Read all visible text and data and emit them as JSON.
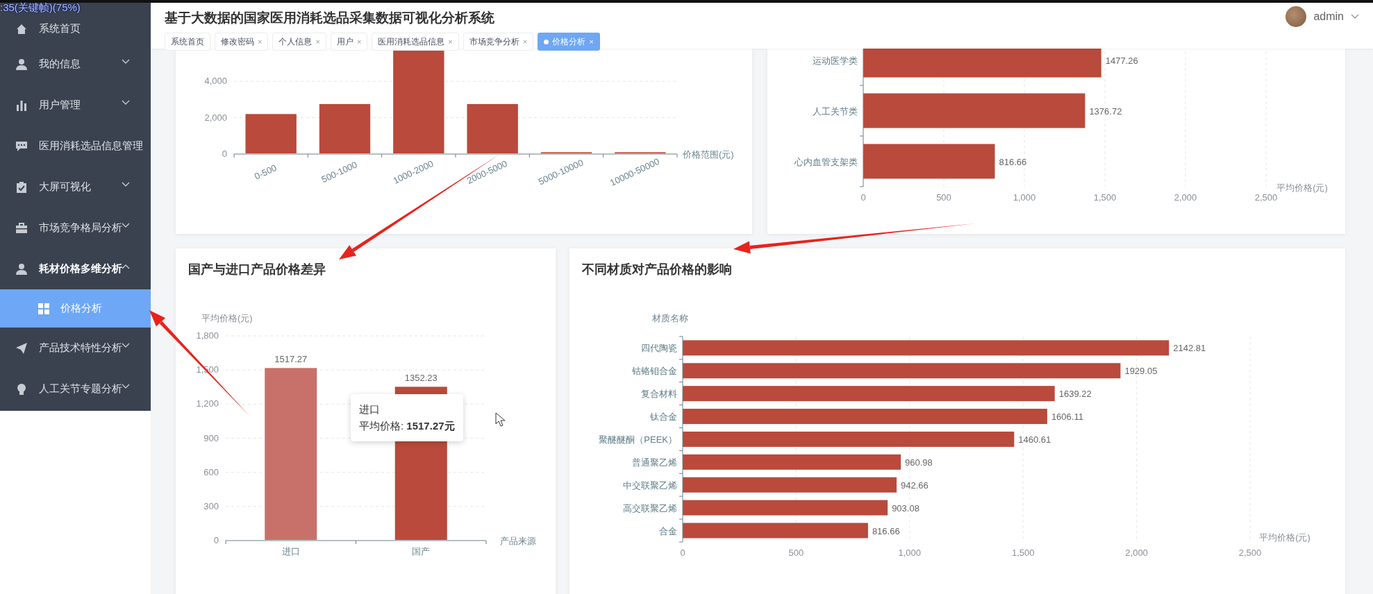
{
  "overlay_text": ":35(关键帧)(75%)",
  "sidebar": {
    "items": [
      {
        "label": "系统首页",
        "kind": "link",
        "expanded": false,
        "selected": false
      },
      {
        "label": "我的信息",
        "kind": "menu",
        "expanded": false,
        "selected": false
      },
      {
        "label": "用户管理",
        "kind": "menu",
        "expanded": false,
        "selected": false
      },
      {
        "label": "医用消耗选品信息管理",
        "kind": "link",
        "expanded": false,
        "selected": false
      },
      {
        "label": "大屏可视化",
        "kind": "menu",
        "expanded": false,
        "selected": false
      },
      {
        "label": "市场竞争格局分析",
        "kind": "menu",
        "expanded": false,
        "selected": false
      },
      {
        "label": "耗材价格多维分析",
        "kind": "menu",
        "expanded": true,
        "selected": false,
        "children": [
          {
            "label": "价格分析",
            "selected": true
          }
        ]
      },
      {
        "label": "产品技术特性分析",
        "kind": "menu",
        "expanded": false,
        "selected": false
      },
      {
        "label": "人工关节专题分析",
        "kind": "menu",
        "expanded": false,
        "selected": false
      }
    ]
  },
  "header": {
    "title": "基于大数据的国家医用消耗选品采集数据可视化分析系统",
    "user": "admin"
  },
  "tabs": [
    {
      "label": "系统首页",
      "selected": false
    },
    {
      "label": "修改密码",
      "close": "×",
      "selected": false
    },
    {
      "label": "个人信息",
      "close": "×",
      "selected": false
    },
    {
      "label": "用户",
      "close": "×",
      "selected": false
    },
    {
      "label": "医用消耗选品信息",
      "close": "×",
      "selected": false
    },
    {
      "label": "市场竞争分析",
      "close": "×",
      "selected": false
    },
    {
      "label": "价格分析",
      "close": "×",
      "selected": true
    }
  ],
  "price_range_card": {
    "chart_data": {
      "type": "bar",
      "xlabel": "价格范围(元)",
      "categories": [
        "0-500",
        "500-1000",
        "1000-2000",
        "2000-5000",
        "5000-10000",
        "10000-50000"
      ],
      "values": [
        2200,
        2750,
        5700,
        2750,
        100,
        100
      ],
      "ylim": [
        0,
        5800
      ],
      "grid": true,
      "yticks": [
        {
          "value": 0,
          "label": "0"
        },
        {
          "value": 2000,
          "label": "2,000"
        },
        {
          "value": 4000,
          "label": "4,000"
        }
      ]
    }
  },
  "category_card": {
    "chart_data": {
      "type": "bar",
      "orientation": "horizontal",
      "xlabel": "平均价格(元)",
      "categories": [
        "运动医学类",
        "人工关节类",
        "心内血管支架类"
      ],
      "values": [
        1477.26,
        1376.72,
        816.66
      ],
      "xlim": [
        0,
        2500
      ],
      "grid": true,
      "xticks": [
        {
          "value": 0,
          "label": "0"
        },
        {
          "value": 500,
          "label": "500"
        },
        {
          "value": 1000,
          "label": "1,000"
        },
        {
          "value": 1500,
          "label": "1,500"
        },
        {
          "value": 2000,
          "label": "2,000"
        },
        {
          "value": 2500,
          "label": "2,500"
        }
      ],
      "data_labels": true
    }
  },
  "origin_card": {
    "title": "国产与进口产品价格差异",
    "chart_data": {
      "type": "bar",
      "ylabel": "平均价格(元)",
      "xlabel": "产品来源",
      "categories": [
        "进口",
        "国产"
      ],
      "values": [
        1517.27,
        1352.23
      ],
      "ylim": [
        0,
        1800
      ],
      "grid": true,
      "yticks": [
        {
          "value": 0,
          "label": "0"
        },
        {
          "value": 300,
          "label": "300"
        },
        {
          "value": 600,
          "label": "600"
        },
        {
          "value": 900,
          "label": "900"
        },
        {
          "value": 1200,
          "label": "1,200"
        },
        {
          "value": 1500,
          "label": "1,500"
        },
        {
          "value": 1800,
          "label": "1,800"
        }
      ],
      "data_labels": true
    },
    "bars": [
      {
        "hovered": true
      },
      {
        "hovered": false
      }
    ],
    "tooltip": {
      "title": "进口",
      "text": "平均价格: **1517.27元**"
    }
  },
  "material_card": {
    "title": "不同材质对产品价格的影响",
    "chart_data": {
      "type": "bar",
      "orientation": "horizontal",
      "ylabel": "材质名称",
      "xlabel": "平均价格(元)",
      "categories": [
        "四代陶瓷",
        "钴铬钼合金",
        "复合材料",
        "钛合金",
        "聚醚醚酮（PEEK）",
        "普通聚乙烯",
        "中交联聚乙烯",
        "高交联聚乙烯",
        "合金"
      ],
      "values": [
        2142.81,
        1929.05,
        1639.22,
        1606.11,
        1460.61,
        960.98,
        942.66,
        903.08,
        816.66
      ],
      "xlim": [
        0,
        2500
      ],
      "grid": true,
      "xticks": [
        {
          "value": 0,
          "label": "0"
        },
        {
          "value": 500,
          "label": "500"
        },
        {
          "value": 1000,
          "label": "1,000"
        },
        {
          "value": 1500,
          "label": "1,500"
        },
        {
          "value": 2000,
          "label": "2,000"
        },
        {
          "value": 2500,
          "label": "2,500"
        }
      ],
      "data_labels": true
    }
  }
}
